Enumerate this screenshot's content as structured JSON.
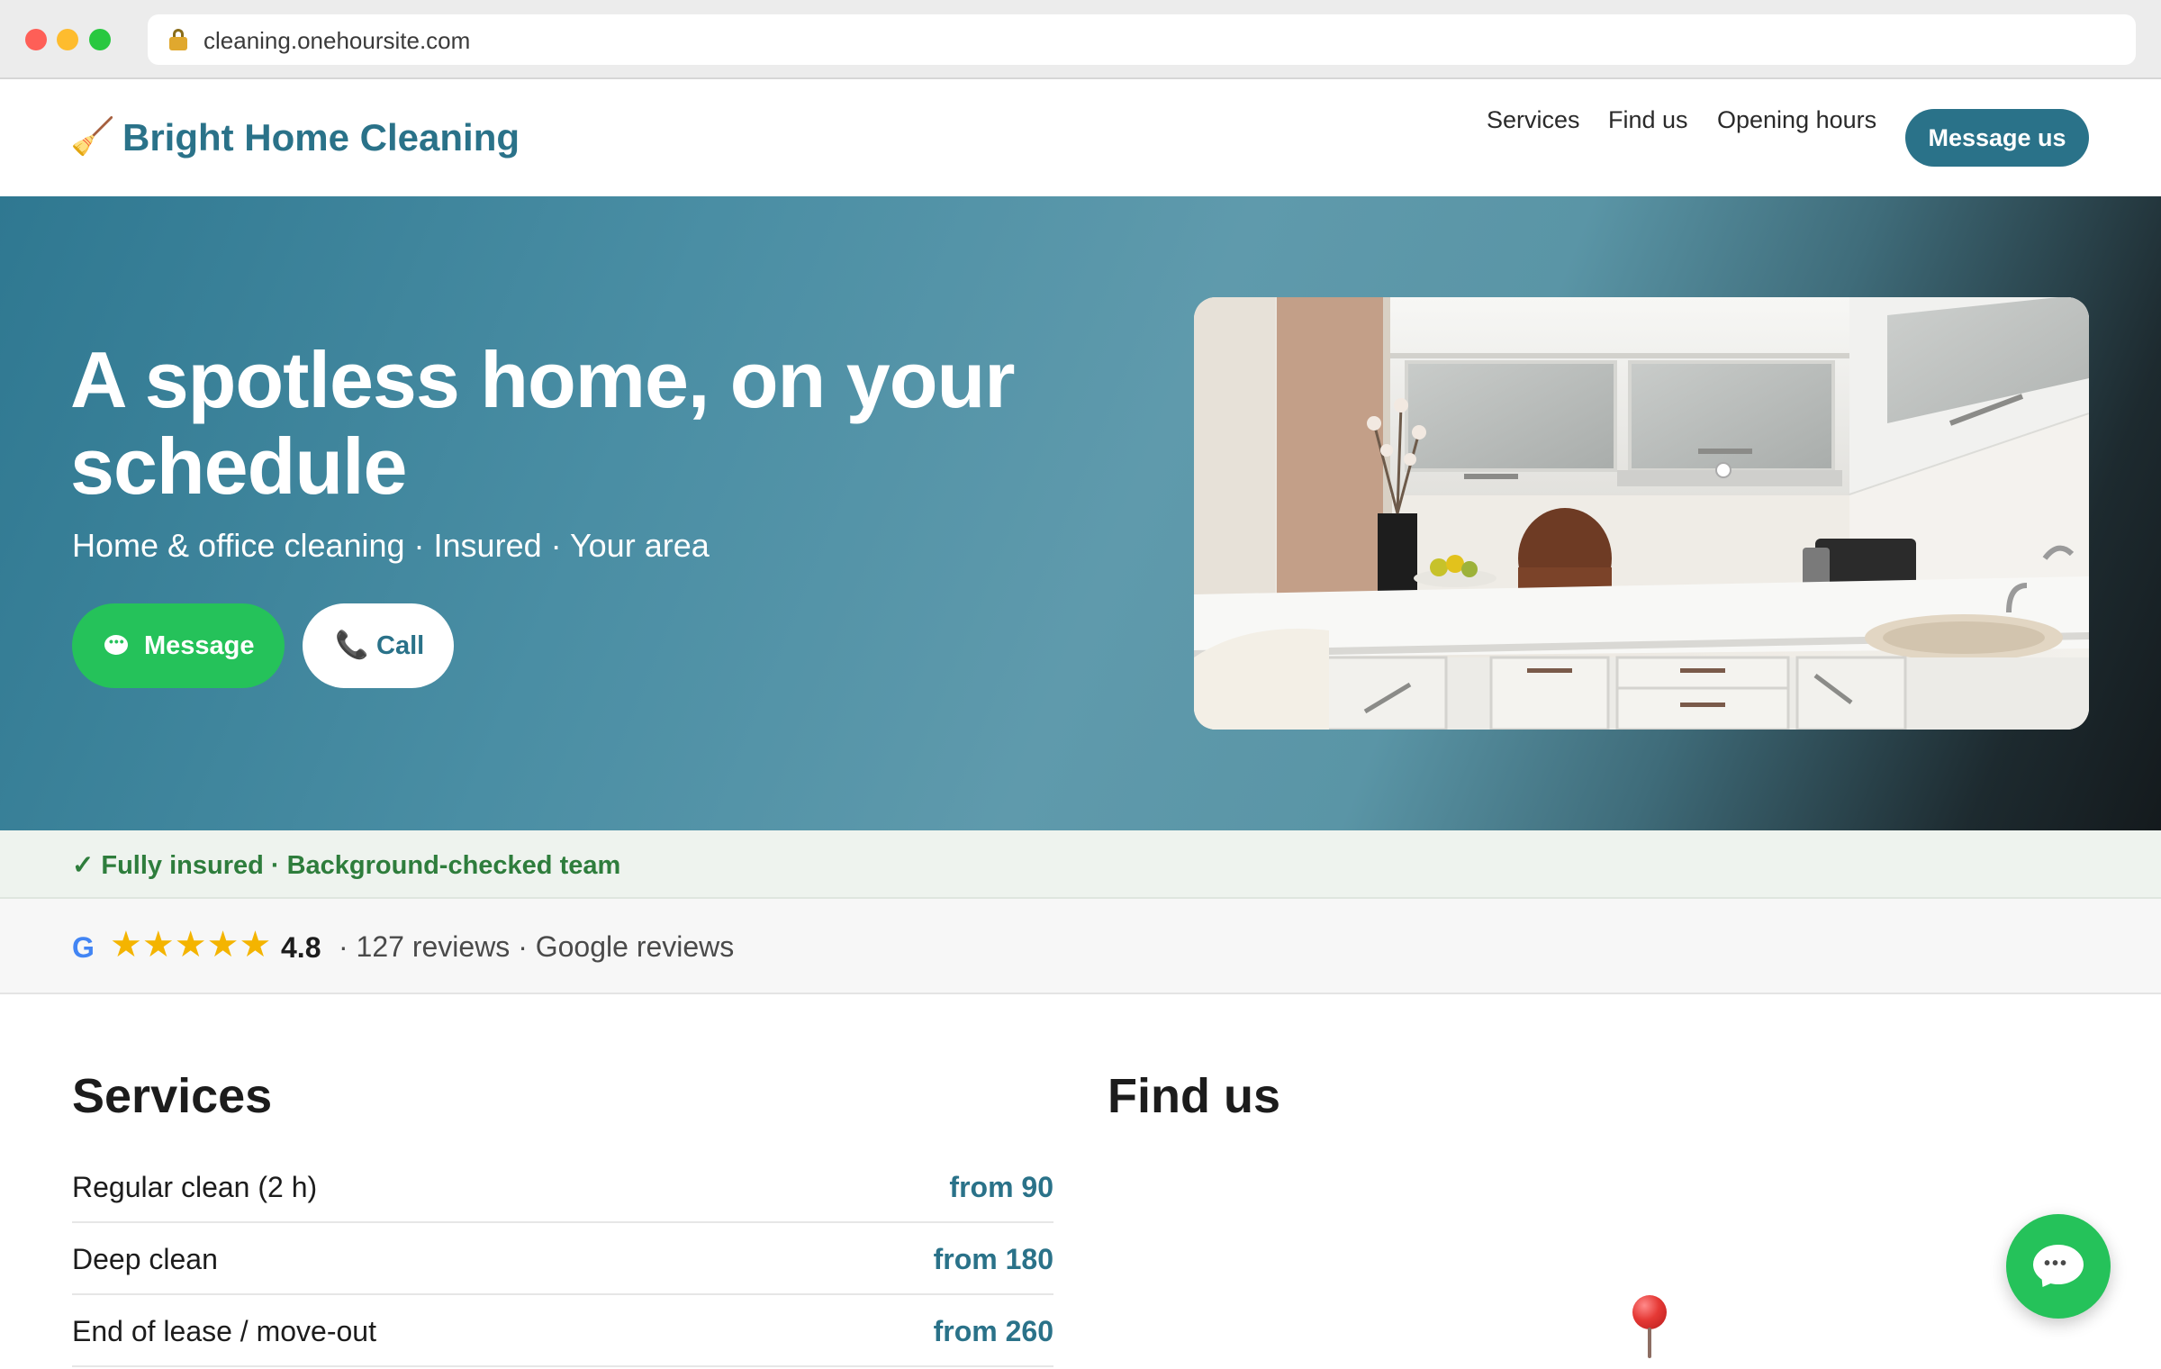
{
  "browser": {
    "url": "cleaning.onehoursite.com"
  },
  "header": {
    "brand": "Bright Home Cleaning",
    "brand_icon": "broom-icon",
    "nav": [
      "Services",
      "Find us",
      "Opening hours"
    ],
    "cta": "Message us"
  },
  "hero": {
    "title": "A spotless home, on your schedule",
    "subtitle": "Home & office cleaning · Insured · Your area",
    "message_button": "Message",
    "call_button": "Call"
  },
  "trust": {
    "text": "✓ Fully insured · Background-checked team"
  },
  "reviews": {
    "source_icon": "G",
    "stars": "★★★★★",
    "rating": "4.8",
    "meta": "· 127 reviews · Google reviews"
  },
  "services": {
    "title": "Services",
    "items": [
      {
        "name": "Regular clean (2 h)",
        "price": "from 90"
      },
      {
        "name": "Deep clean",
        "price": "from 180"
      },
      {
        "name": "End of lease / move-out",
        "price": "from 260"
      }
    ]
  },
  "findus": {
    "title": "Find us",
    "map_icon": "pushpin-icon"
  },
  "colors": {
    "brand": "#2a7289",
    "whatsapp_green": "#25c25a",
    "trust_green": "#2e7d3c",
    "star_yellow": "#f4b400"
  }
}
